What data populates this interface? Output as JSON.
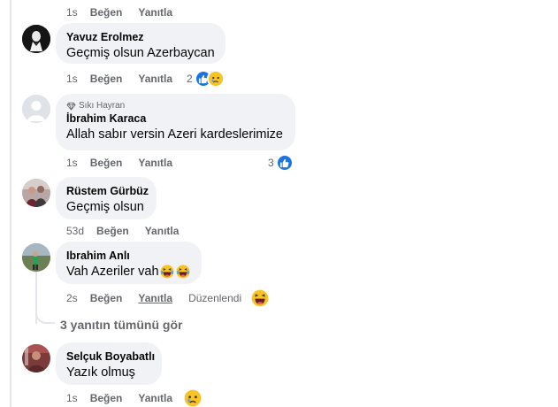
{
  "labels": {
    "like": "Beğen",
    "reply": "Yanıtla",
    "edited": "Düzenlendi"
  },
  "top_stub": {
    "time": "1s"
  },
  "comments": [
    {
      "author": "Yavuz Erolmez",
      "text": "Geçmiş olsun Azerbaycan",
      "time": "1s",
      "reaction_count": "2",
      "reactions": [
        "like-icon",
        "sad-icon"
      ]
    },
    {
      "badge": "Sıkı Hayran",
      "badge_icon": "diamond-icon",
      "author": "İbrahim Karaca",
      "text": "Allah sabır versin Azeri kardeslerimize",
      "time": "1s",
      "reaction_count": "3",
      "reactions": [
        "like-icon"
      ]
    },
    {
      "author": "Rüstem Gürbüz",
      "text": "Geçmiş olsun",
      "time": "53d"
    },
    {
      "author": "Ibrahim Anlı",
      "text": "Vah Azeriler vah",
      "time": "2s",
      "reactions": [
        "laughing-icon"
      ]
    },
    {
      "author": "Selçuk Boyabatlı",
      "text": "Yazık olmuş",
      "time": "1s",
      "reactions": [
        "sad-icon"
      ]
    }
  ],
  "see_replies": "3 yanıtın tümünü gör",
  "colors": {
    "bubble": "#f0f2f5",
    "secondary_text": "#65676b",
    "like_blue": "#1b74e4",
    "emoji_yellow": "#f7c325"
  }
}
